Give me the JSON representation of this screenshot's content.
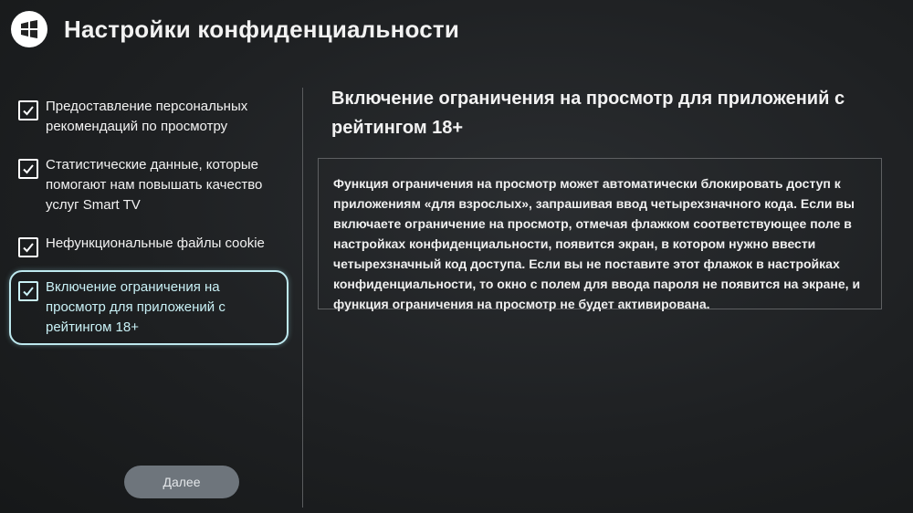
{
  "header": {
    "logo_icon": "app-grid-logo-icon",
    "title": "Настройки конфиденциальности"
  },
  "options": [
    {
      "label": "Предоставление персональных рекомендаций по просмотру",
      "checked": true,
      "selected": false
    },
    {
      "label": "Статистические данные, которые помогают нам повышать качество услуг Smart TV",
      "checked": true,
      "selected": false
    },
    {
      "label": "Нефункциональные файлы cookie",
      "checked": true,
      "selected": false
    },
    {
      "label": "Включение ограничения на просмотр для приложений с рейтингом 18+",
      "checked": true,
      "selected": true
    }
  ],
  "detail": {
    "title": "Включение ограничения на просмотр для приложений с рейтингом 18+",
    "body": "Функция ограничения на просмотр может автоматически блокировать доступ к приложениям «для взрослых», запрашивая ввод четырехзначного кода. Если вы включаете ограничение на просмотр, отмечая флажком соответствующее поле в настройках конфиденциальности, появится экран, в котором нужно ввести четырехзначный код доступа. Если вы не поставите этот флажок в настройках конфиденциальности, то окно с полем для ввода пароля не появится на экране, и функция ограничения на просмотр не будет активирована."
  },
  "footer": {
    "next_label": "Далее"
  },
  "colors": {
    "accent": "#bde8ee",
    "button_bg": "#6e757c",
    "background": "#1e2022"
  }
}
